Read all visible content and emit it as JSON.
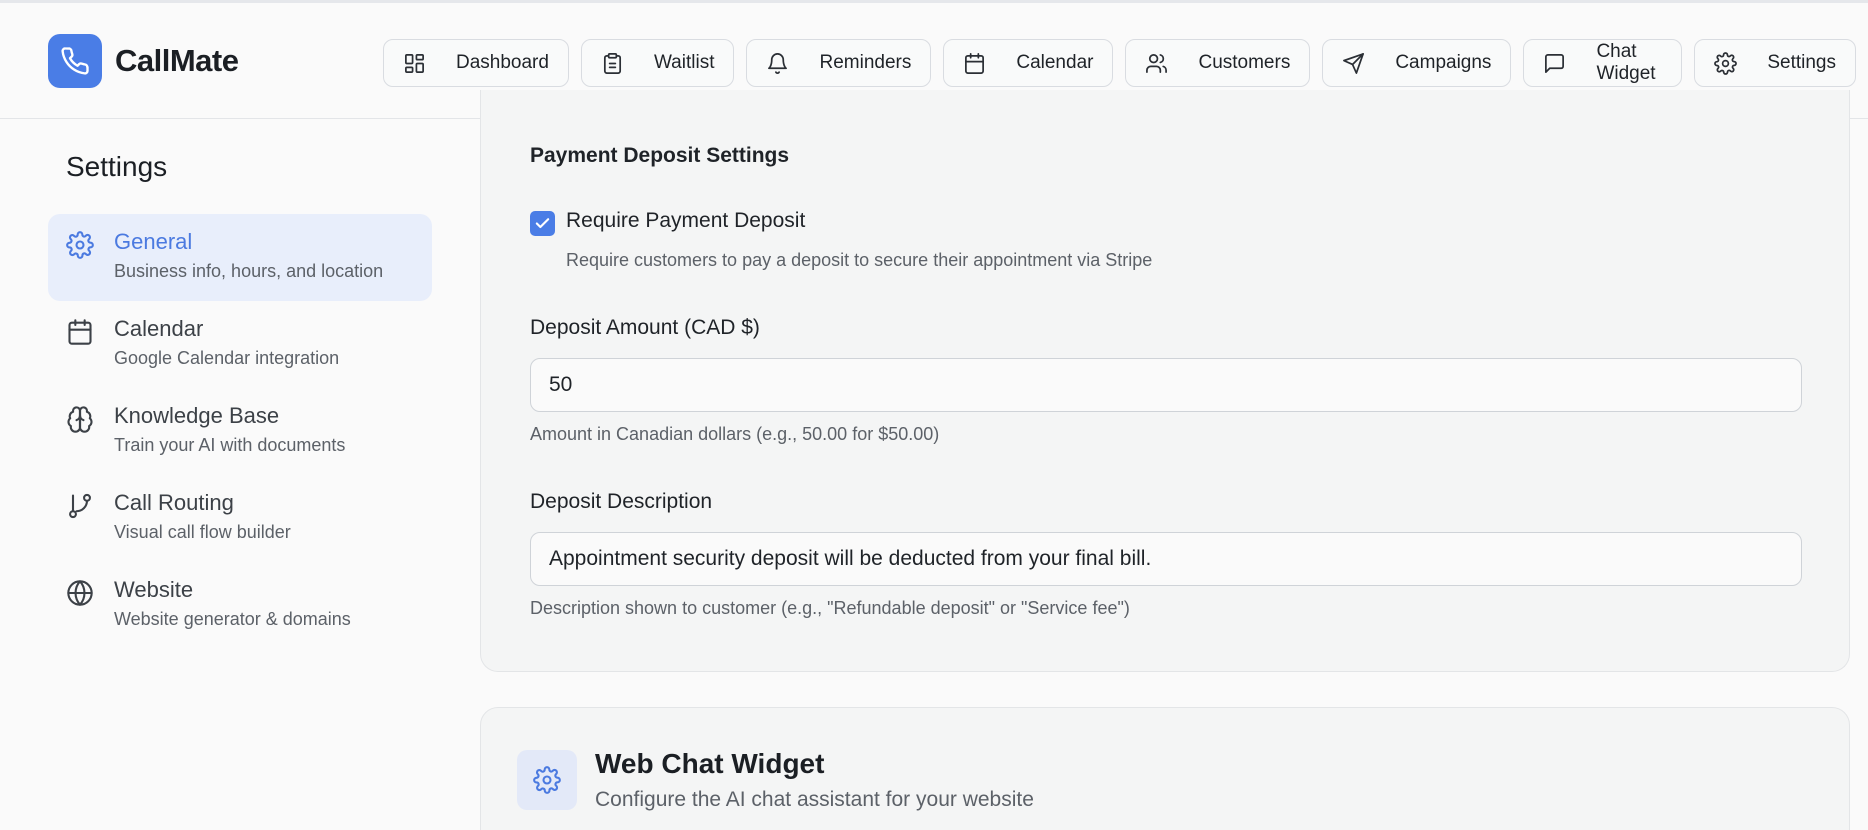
{
  "app": {
    "name": "CallMate",
    "logo_icon": "phone-icon",
    "accent": "#4a7de6"
  },
  "nav": [
    {
      "label": "Dashboard",
      "icon": "dashboard-icon"
    },
    {
      "label": "Waitlist",
      "icon": "clipboard-icon"
    },
    {
      "label": "Reminders",
      "icon": "bell-icon"
    },
    {
      "label": "Calendar",
      "icon": "calendar-icon"
    },
    {
      "label": "Customers",
      "icon": "users-icon"
    },
    {
      "label": "Campaigns",
      "icon": "send-icon"
    },
    {
      "label": "Chat Widget",
      "icon": "message-icon"
    },
    {
      "label": "Settings",
      "icon": "gear-icon"
    }
  ],
  "sidebar": {
    "title": "Settings",
    "items": [
      {
        "label": "General",
        "description": "Business info, hours, and location",
        "icon": "gear-icon",
        "active": true
      },
      {
        "label": "Calendar",
        "description": "Google Calendar integration",
        "icon": "calendar-icon"
      },
      {
        "label": "Knowledge Base",
        "description": "Train your AI with documents",
        "icon": "brain-icon"
      },
      {
        "label": "Call Routing",
        "description": "Visual call flow builder",
        "icon": "git-branch-icon"
      },
      {
        "label": "Website",
        "description": "Website generator & domains",
        "icon": "globe-icon"
      }
    ]
  },
  "payment": {
    "section_title": "Payment Deposit Settings",
    "require_label": "Require Payment Deposit",
    "require_checked": true,
    "require_description": "Require customers to pay a deposit to secure their appointment via Stripe",
    "amount_label": "Deposit Amount (CAD $)",
    "amount_value": "50",
    "amount_help": "Amount in Canadian dollars (e.g., 50.00 for $50.00)",
    "description_label": "Deposit Description",
    "description_value": "Appointment security deposit will be deducted from your final bill.",
    "description_help": "Description shown to customer (e.g., \"Refundable deposit\" or \"Service fee\")"
  },
  "widget": {
    "title": "Web Chat Widget",
    "description": "Configure the AI chat assistant for your website",
    "icon": "gear-icon"
  }
}
